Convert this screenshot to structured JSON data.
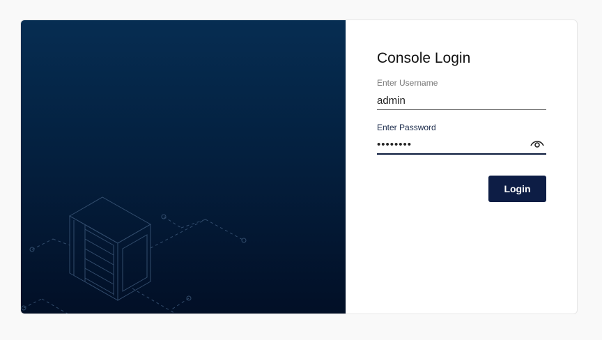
{
  "login": {
    "title": "Console Login",
    "username_label": "Enter Username",
    "username_value": "admin",
    "password_label": "Enter Password",
    "password_value": "••••••••",
    "login_button": "Login"
  },
  "colors": {
    "hero_gradient_top": "#062d52",
    "hero_gradient_bottom": "#020f26",
    "button": "#0d1d45",
    "card": "#ffffff",
    "page_background": "#f9f9f9"
  },
  "icons": {
    "password_toggle": "eye-icon",
    "illustration": "server-cabinet-illustration"
  }
}
